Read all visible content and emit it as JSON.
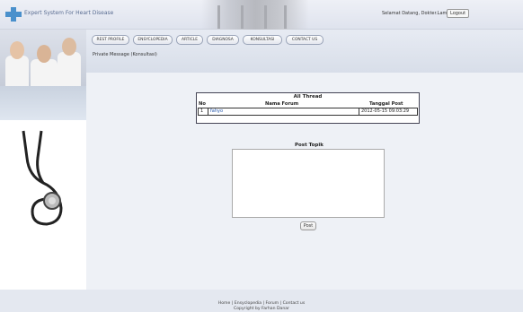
{
  "header": {
    "title": "Expert System For Heart Disease",
    "welcome": "Selamat Datang, Dokter.Lamiani",
    "logout_label": "Logout"
  },
  "nav": {
    "items": [
      "REST PROFILE",
      "ENSYCLOPEDIA",
      "ARTICLE",
      "DIAGNOSA",
      "KONSULTASI",
      "CONTACT US"
    ]
  },
  "breadcrumb": "Private Message (Konsultasi)",
  "thread_table": {
    "caption": "All Thread",
    "columns": [
      "No",
      "Nama Forum",
      "Tanggal Post"
    ],
    "rows": [
      {
        "no": "1",
        "name": "fahyo",
        "date": "2012-05-15 09:03:29"
      }
    ]
  },
  "post": {
    "title": "Post Topik",
    "textarea_value": "",
    "button_label": "Post"
  },
  "footer": {
    "line1": "Home | Ensyclopedia | Forum | Contact us",
    "line2": "Copyright by Farhan Danar"
  },
  "colors": {
    "accent": "#4a90cc",
    "header_bg": "#dfe3ee",
    "content_bg": "#eef1f6"
  }
}
